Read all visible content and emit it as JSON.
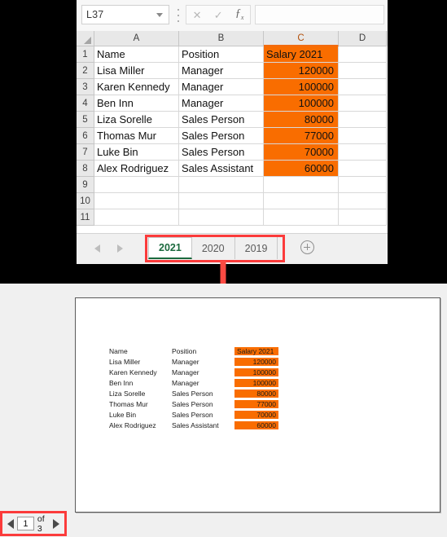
{
  "colors": {
    "highlight_orange": "#F96D00",
    "annotation_red": "#FB3B3B",
    "active_tab_green": "#1B6A3E"
  },
  "excel": {
    "name_box": {
      "value": "L37"
    },
    "formula_bar": {
      "value": "",
      "cancel_icon": "close-icon",
      "confirm_icon": "check-icon",
      "function_icon": "fx-icon"
    },
    "columns": [
      "A",
      "B",
      "C",
      "D"
    ],
    "selected_column": "C",
    "row_numbers": [
      "1",
      "2",
      "3",
      "4",
      "5",
      "6",
      "7",
      "8",
      "9",
      "10",
      "11"
    ],
    "rows": [
      {
        "num": "1",
        "a": "Name",
        "b": "Position",
        "c": "Salary 2021",
        "c_style": "orange-header"
      },
      {
        "num": "2",
        "a": "Lisa Miller",
        "b": "Manager",
        "c": "120000",
        "c_style": "orange-number"
      },
      {
        "num": "3",
        "a": "Karen Kennedy",
        "b": "Manager",
        "c": "100000",
        "c_style": "orange-number"
      },
      {
        "num": "4",
        "a": "Ben Inn",
        "b": "Manager",
        "c": "100000",
        "c_style": "orange-number"
      },
      {
        "num": "5",
        "a": "Liza Sorelle",
        "b": "Sales Person",
        "c": "80000",
        "c_style": "orange-number"
      },
      {
        "num": "6",
        "a": "Thomas Mur",
        "b": "Sales Person",
        "c": "77000",
        "c_style": "orange-number"
      },
      {
        "num": "7",
        "a": "Luke Bin",
        "b": "Sales Person",
        "c": "70000",
        "c_style": "orange-number"
      },
      {
        "num": "8",
        "a": "Alex Rodriguez",
        "b": "Sales Assistant",
        "c": "60000",
        "c_style": "orange-number"
      },
      {
        "num": "9",
        "a": "",
        "b": "",
        "c": "",
        "c_style": ""
      },
      {
        "num": "10",
        "a": "",
        "b": "",
        "c": "",
        "c_style": ""
      },
      {
        "num": "11",
        "a": "",
        "b": "",
        "c": "",
        "c_style": ""
      }
    ],
    "sheet_tabs": {
      "prev_icon": "nav-prev-icon",
      "next_icon": "nav-next-icon",
      "add_icon": "add-sheet-icon",
      "tabs": [
        {
          "label": "2021",
          "active": true
        },
        {
          "label": "2020",
          "active": false
        },
        {
          "label": "2019",
          "active": false
        }
      ]
    }
  },
  "annotations": {
    "arrow_icon": "down-arrow-annotation",
    "tab_box_label": "sheet-tabs-highlight",
    "page_nav_box_label": "page-navigator-highlight"
  },
  "preview": {
    "table": {
      "header": {
        "name": "Name",
        "position": "Position",
        "salary": "Salary 2021"
      },
      "rows": [
        {
          "name": "Lisa Miller",
          "position": "Manager",
          "salary": "120000"
        },
        {
          "name": "Karen Kennedy",
          "position": "Manager",
          "salary": "100000"
        },
        {
          "name": "Ben Inn",
          "position": "Manager",
          "salary": "100000"
        },
        {
          "name": "Liza Sorelle",
          "position": "Sales Person",
          "salary": "80000"
        },
        {
          "name": "Thomas Mur",
          "position": "Sales Person",
          "salary": "77000"
        },
        {
          "name": "Luke Bin",
          "position": "Sales Person",
          "salary": "70000"
        },
        {
          "name": "Alex Rodriguez",
          "position": "Sales Assistant",
          "salary": "60000"
        }
      ]
    }
  },
  "page_nav": {
    "prev_icon": "page-prev-icon",
    "next_icon": "page-next-icon",
    "current_page": "1",
    "total_label": "of 3"
  }
}
